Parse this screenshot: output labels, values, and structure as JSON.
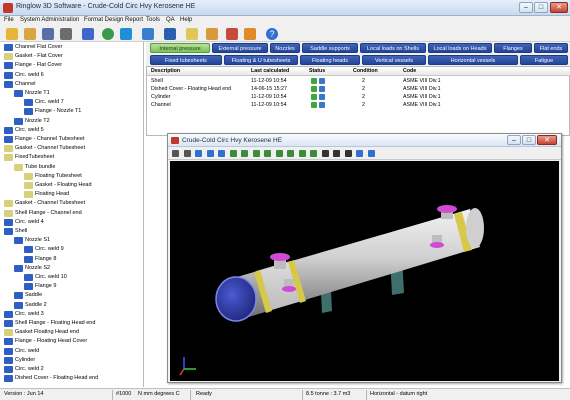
{
  "window": {
    "title": "Ringlow 3D Software - Crude-Cold Circ Hvy Kerosene HE"
  },
  "window_buttons": {
    "minimize": "–",
    "maximize": "□",
    "close": "✕"
  },
  "menu": [
    "File",
    "System Administration",
    "Format Design Report",
    "Tools",
    "QA",
    "Help"
  ],
  "toolbar_icons": [
    "folder-open-icon",
    "open-icon",
    "save-icon",
    "print-icon",
    "web-icon",
    "refresh-icon",
    "filter-icon",
    "run-icon",
    "sigma-icon",
    "export-icon",
    "report-icon",
    "settings-icon",
    "tools-icon",
    "help-icon"
  ],
  "tree": [
    {
      "label": "Channel Flat Cover",
      "color": "#2f5ec4",
      "indent": 0
    },
    {
      "label": "Gasket - Flat Cover",
      "color": "#d8d07a",
      "indent": 0
    },
    {
      "label": "Flange - Flat Cover",
      "color": "#2f5ec4",
      "indent": 0
    },
    {
      "label": "Circ. weld 6",
      "color": "#2f5ec4",
      "indent": 0
    },
    {
      "label": "Channel",
      "color": "#2f5ec4",
      "indent": 0
    },
    {
      "label": "Nozzle T1",
      "color": "#2f5ec4",
      "indent": 1
    },
    {
      "label": "Circ. weld 7",
      "color": "#2f5ec4",
      "indent": 2
    },
    {
      "label": "Flange - Nozzle T1",
      "color": "#2f5ec4",
      "indent": 2
    },
    {
      "label": "Nozzle T2",
      "color": "#2f5ec4",
      "indent": 1
    },
    {
      "label": "Circ. weld 5",
      "color": "#2f5ec4",
      "indent": 0
    },
    {
      "label": "Flange - Channel Tubesheet",
      "color": "#2f5ec4",
      "indent": 0
    },
    {
      "label": "Gasket - Channel Tubesheet",
      "color": "#d8d07a",
      "indent": 0
    },
    {
      "label": "FixedTubesheet",
      "color": "#d8d07a",
      "indent": 0
    },
    {
      "label": "Tube bundle",
      "color": "#d8d07a",
      "indent": 1
    },
    {
      "label": "Floating Tubesheet",
      "color": "#d8d07a",
      "indent": 2
    },
    {
      "label": "Gasket - Floating Head",
      "color": "#d8d07a",
      "indent": 2
    },
    {
      "label": "Floating Head",
      "color": "#d8d07a",
      "indent": 2
    },
    {
      "label": "Gasket - Channel Tubesheet",
      "color": "#d8d07a",
      "indent": 0
    },
    {
      "label": "Shell Flange - Channel end",
      "color": "#d8d07a",
      "indent": 0
    },
    {
      "label": "Circ. weld 4",
      "color": "#2f5ec4",
      "indent": 0
    },
    {
      "label": "Shell",
      "color": "#2f5ec4",
      "indent": 0
    },
    {
      "label": "Nozzle S1",
      "color": "#2f5ec4",
      "indent": 1
    },
    {
      "label": "Circ. weld 9",
      "color": "#2f5ec4",
      "indent": 2
    },
    {
      "label": "Flange 8",
      "color": "#2f5ec4",
      "indent": 2
    },
    {
      "label": "Nozzle S2",
      "color": "#2f5ec4",
      "indent": 1
    },
    {
      "label": "Circ. weld 10",
      "color": "#2f5ec4",
      "indent": 2
    },
    {
      "label": "Flange 9",
      "color": "#2f5ec4",
      "indent": 2
    },
    {
      "label": "Saddle",
      "color": "#2f5ec4",
      "indent": 1
    },
    {
      "label": "Saddle 2",
      "color": "#2f5ec4",
      "indent": 1
    },
    {
      "label": "Circ. weld 3",
      "color": "#2f5ec4",
      "indent": 0
    },
    {
      "label": "Shell Flange - Floating Head end",
      "color": "#2f5ec4",
      "indent": 0
    },
    {
      "label": "Gasket Floating Head end",
      "color": "#d8d07a",
      "indent": 0
    },
    {
      "label": "Flange - Floating Head Cover",
      "color": "#2f5ec4",
      "indent": 0
    },
    {
      "label": "Circ. weld",
      "color": "#2f5ec4",
      "indent": 0
    },
    {
      "label": "Cylinder",
      "color": "#2f5ec4",
      "indent": 0
    },
    {
      "label": "Circ. weld 2",
      "color": "#2f5ec4",
      "indent": 0
    },
    {
      "label": "Dished Cover - Floating Head end",
      "color": "#2f5ec4",
      "indent": 0
    }
  ],
  "tabs_row1": [
    {
      "label": "Internal pressure",
      "active": true
    },
    {
      "label": "External pressure",
      "active": false
    },
    {
      "label": "Nozzles",
      "active": false
    },
    {
      "label": "Saddle supports",
      "active": false
    },
    {
      "label": "Local loads on Shells",
      "active": false
    },
    {
      "label": "Local loads on Heads",
      "active": false
    },
    {
      "label": "Flanges",
      "active": false
    },
    {
      "label": "Flat ends",
      "active": false
    }
  ],
  "tabs_row2": [
    {
      "label": "Fixed tubesheets",
      "active": false
    },
    {
      "label": "Floating & U tubesheets",
      "active": false
    },
    {
      "label": "Floating heads",
      "active": false
    },
    {
      "label": "Vertical vessels",
      "active": false
    },
    {
      "label": "Horizontal vessels",
      "active": false
    },
    {
      "label": "Fatigue",
      "active": false
    }
  ],
  "table": {
    "headers": [
      "Description",
      "Last calculated",
      "Status",
      "Condition",
      "Code"
    ],
    "rows": [
      {
        "description": "Shell",
        "last_calculated": "11-12-09 10:54",
        "condition": "2",
        "code": "ASME VIII Div.1"
      },
      {
        "description": "Dished Cover - Floating Head end",
        "last_calculated": "14-06-15 15:27",
        "condition": "2",
        "code": "ASME VIII Div.1"
      },
      {
        "description": "Cylinder",
        "last_calculated": "11-12-09 10:54",
        "condition": "2",
        "code": "ASME VIII Div.1"
      },
      {
        "description": "Channel",
        "last_calculated": "11-12-09 10:54",
        "condition": "2",
        "code": "ASME VIII Div.1"
      }
    ]
  },
  "viewer": {
    "title": "Crude-Cold Circ Hvy Kerosene HE"
  },
  "viewer_tools": [
    "zoom-in-icon",
    "zoom-out-icon",
    "pan-left-icon",
    "pan-right-icon",
    "rotate-icon",
    "view-top-icon",
    "view-front-icon",
    "view-side-icon",
    "view-iso-icon",
    "view-back-icon",
    "view-bottom-icon",
    "view-left-icon",
    "view-right-icon",
    "section-icon",
    "fit-icon",
    "camera-icon",
    "color-icon",
    "help-icon"
  ],
  "status": {
    "version": "Version : Jun 14",
    "job": "#1000",
    "units": "N mm degrees C",
    "state": "Ready",
    "weight": "8.5 tonne : 3.7 m3",
    "orientation": "Horizontal - datum right"
  },
  "colors": {
    "tab_blue": "#23459a",
    "tab_active": "#7cc25a",
    "tree_blue": "#2f5ec4",
    "tree_yellow": "#d8d07a",
    "vessel": "#d8d8d8",
    "nozzle": "#d04ad4"
  }
}
